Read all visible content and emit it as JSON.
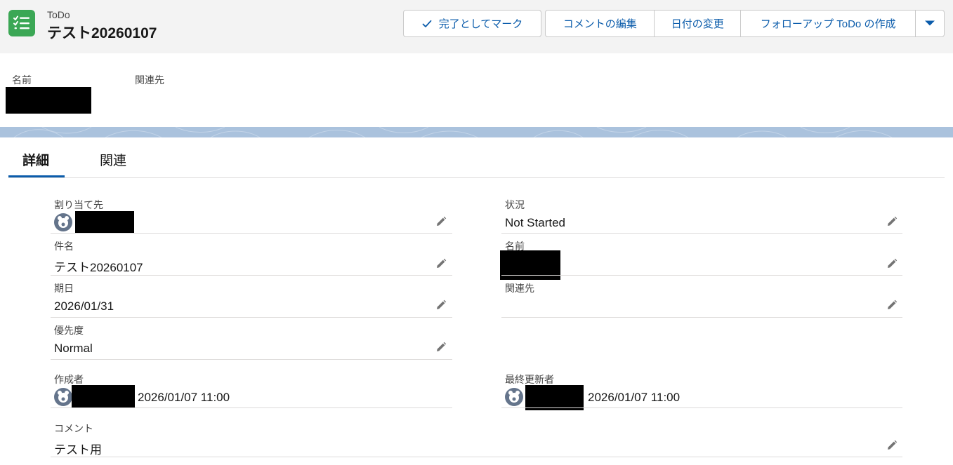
{
  "header": {
    "object_label": "ToDo",
    "record_title": "テスト20260107",
    "buttons": {
      "mark_complete": "完了としてマーク",
      "edit_comment": "コメントの編集",
      "change_date": "日付の変更",
      "create_followup": "フォローアップ ToDo の作成"
    }
  },
  "highlights": {
    "name_label": "名前",
    "related_label": "関連先"
  },
  "tabs": {
    "details": "詳細",
    "related": "関連"
  },
  "fields": {
    "assigned_to_label": "割り当て先",
    "status_label": "状況",
    "status_value": "Not Started",
    "subject_label": "件名",
    "subject_value": "テスト20260107",
    "name_label": "名前",
    "due_date_label": "期日",
    "due_date_value": "2026/01/31",
    "related_label": "関連先",
    "priority_label": "優先度",
    "priority_value": "Normal",
    "created_by_label": "作成者",
    "created_by_date": "2026/01/07 11:00",
    "modified_by_label": "最終更新者",
    "modified_by_date": "2026/01/07 11:00",
    "comment_label": "コメント",
    "comment_value": "テスト用"
  },
  "colors": {
    "brand_blue": "#0b5cab",
    "todo_green": "#3ba755",
    "band_blue": "#aac2dd"
  }
}
